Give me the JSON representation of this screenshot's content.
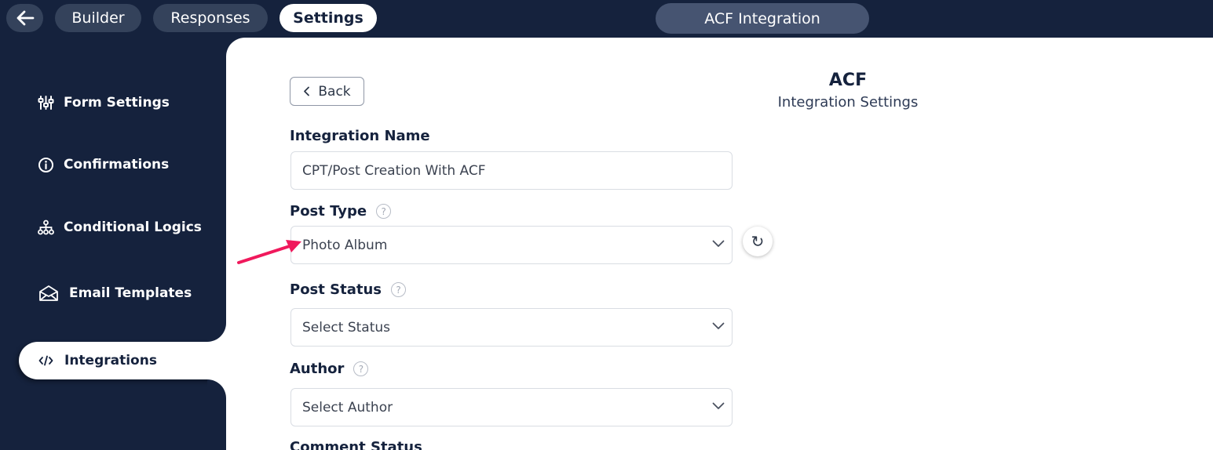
{
  "topbar": {
    "back_icon": "arrow-left-icon",
    "tabs": [
      {
        "label": "Builder",
        "active": false
      },
      {
        "label": "Responses",
        "active": false
      },
      {
        "label": "Settings",
        "active": true
      }
    ],
    "title": "ACF Integration"
  },
  "sidebar": {
    "items": [
      {
        "label": "Form Settings",
        "icon": "sliders-icon"
      },
      {
        "label": "Confirmations",
        "icon": "info-circle-icon"
      },
      {
        "label": "Conditional Logics",
        "icon": "sitemap-icon"
      },
      {
        "label": "Email Templates",
        "icon": "envelope-open-icon"
      },
      {
        "label": "Integrations",
        "icon": "code-icon",
        "active": true
      }
    ]
  },
  "main": {
    "back_label": "Back",
    "heading": "ACF",
    "subheading": "Integration Settings",
    "fields": {
      "integration_name": {
        "label": "Integration Name",
        "value": "CPT/Post Creation With ACF"
      },
      "post_type": {
        "label": "Post Type",
        "value": "Photo Album"
      },
      "post_status": {
        "label": "Post Status",
        "placeholder": "Select Status"
      },
      "author": {
        "label": "Author",
        "placeholder": "Select Author"
      },
      "comment_status": {
        "label": "Comment Status"
      }
    },
    "help_glyph": "?",
    "refresh_glyph": "↻"
  },
  "colors": {
    "navy": "#15223d",
    "pill": "#34425b",
    "title_pill": "#465471",
    "annotation_arrow": "#f0195c"
  }
}
